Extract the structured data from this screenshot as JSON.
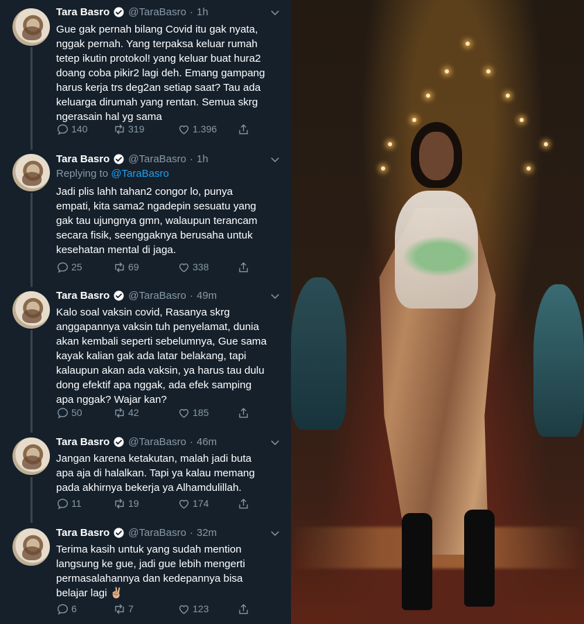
{
  "user": {
    "name": "Tara Basro",
    "handle": "@TaraBasro"
  },
  "tweets": [
    {
      "time": "1h",
      "text": "Gue gak pernah bilang Covid itu gak nyata,\nnggak pernah. Yang terpaksa keluar rumah\ntetep ikutin protokol! yang keluar buat hura2\ndoang coba pikir2 lagi deh. Emang gampang\nharus kerja trs deg2an setiap saat? Tau ada\nkeluarga dirumah yang rentan. Semua skrg\nngerasain hal yg sama",
      "replies": "140",
      "retweets": "319",
      "likes": "1.396"
    },
    {
      "time": "1h",
      "replying_label": "Replying to",
      "replying_to": "@TaraBasro",
      "text": "Jadi plis lahh tahan2 congor lo, punya\nempati, kita sama2 ngadepin sesuatu yang\ngak tau ujungnya gmn, walaupun terancam\nsecara fisik, seenggaknya berusaha untuk\nkesehatan mental di jaga.",
      "replies": "25",
      "retweets": "69",
      "likes": "338"
    },
    {
      "time": "49m",
      "text": "Kalo soal vaksin covid, Rasanya skrg\nanggapannya vaksin tuh penyelamat, dunia\nakan kembali seperti sebelumnya, Gue sama\nkayak kalian gak ada latar belakang, tapi\nkalaupun akan ada vaksin, ya harus tau dulu\ndong efektif apa nggak, ada efek samping\napa nggak? Wajar kan?",
      "replies": "50",
      "retweets": "42",
      "likes": "185"
    },
    {
      "time": "46m",
      "text": "Jangan karena ketakutan, malah jadi buta\napa aja di halalkan. Tapi ya kalau memang\npada akhirnya bekerja ya Alhamdulillah.",
      "replies": "11",
      "retweets": "19",
      "likes": "174"
    },
    {
      "time": "32m",
      "text": "Terima kasih untuk yang sudah mention\nlangsung ke gue, jadi gue lebih mengerti\npermasalahannya dan kedepannya bisa\nbelajar lagi ✌🏼",
      "replies": "6",
      "retweets": "7",
      "likes": "123"
    }
  ],
  "icons": {
    "verified": "verified-badge-icon",
    "chevron": "chevron-down-icon",
    "reply": "reply-icon",
    "retweet": "retweet-icon",
    "like": "like-icon",
    "share": "share-icon"
  },
  "colors": {
    "background": "#15202b",
    "text": "#ffffff",
    "muted": "#8899a6",
    "link": "#1da1f2",
    "thread_line": "#38444d"
  }
}
